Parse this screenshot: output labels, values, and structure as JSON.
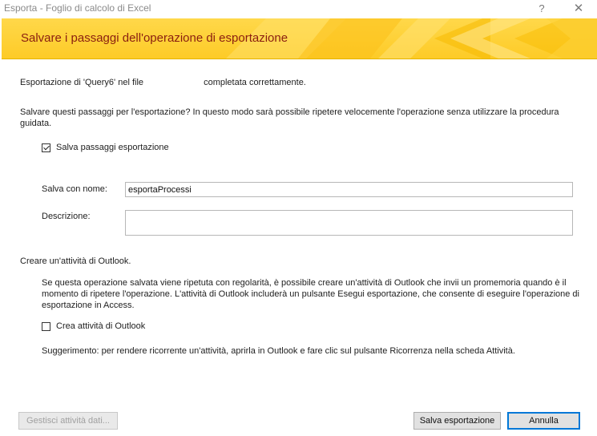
{
  "window": {
    "title": "Esporta - Foglio di calcolo di Excel",
    "help_icon": "?",
    "close_icon": "✕"
  },
  "banner": {
    "title": "Salvare i passaggi dell'operazione di esportazione",
    "color": "#fdcb27",
    "title_color": "#8a1e10"
  },
  "message": {
    "prefix": "Esportazione di 'Query6' nel file",
    "suffix": "completata correttamente."
  },
  "question": "Salvare questi passaggi per l'esportazione? In questo modo sarà possibile ripetere velocemente l'operazione senza utilizzare la procedura guidata.",
  "save_steps": {
    "label": "Salva passaggi esportazione",
    "checked": true
  },
  "form": {
    "name_label": "Salva con nome:",
    "name_value": "esportaProcessi",
    "description_label": "Descrizione:",
    "description_value": ""
  },
  "outlook": {
    "heading": "Creare un'attività di Outlook.",
    "description": "Se questa operazione salvata viene ripetuta con regolarità, è possibile creare un'attività di Outlook che invii un promemoria quando è il momento di ripetere l'operazione. L'attività di Outlook includerà un pulsante Esegui esportazione, che consente di eseguire l'operazione di esportazione in Access.",
    "checkbox_label": "Crea attività di Outlook",
    "checked": false,
    "tip": "Suggerimento: per rendere ricorrente un'attività, aprirla in Outlook e fare clic sul pulsante Ricorrenza nella scheda Attività."
  },
  "buttons": {
    "manage": "Gestisci attività dati...",
    "save_export": "Salva esportazione",
    "cancel": "Annulla"
  }
}
